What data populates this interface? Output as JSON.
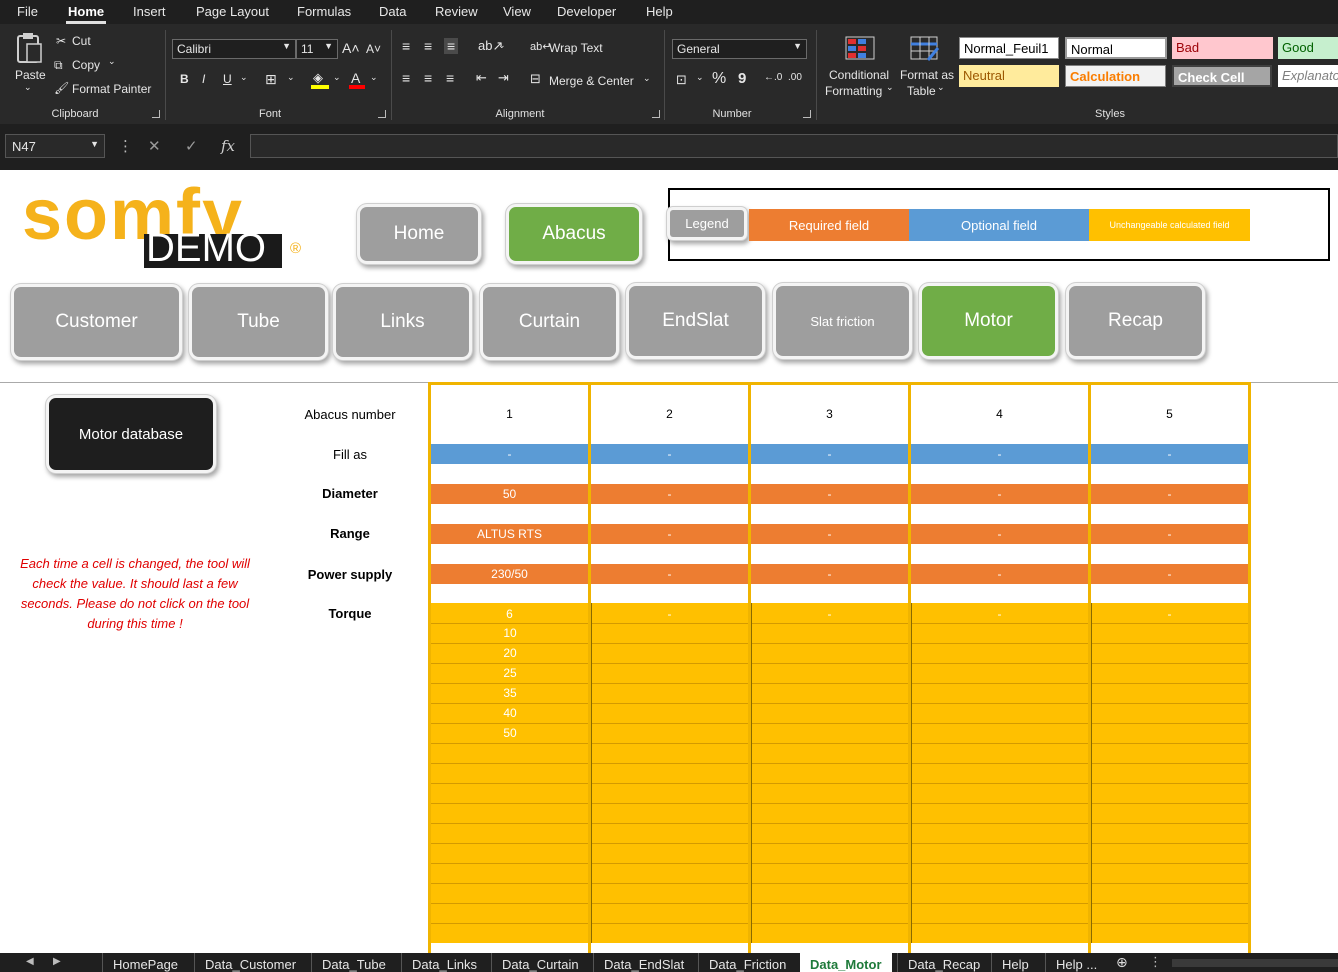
{
  "menu": {
    "items": [
      "File",
      "Home",
      "Insert",
      "Page Layout",
      "Formulas",
      "Data",
      "Review",
      "View",
      "Developer",
      "Help"
    ],
    "active": "Home"
  },
  "ribbon": {
    "clipboard": {
      "paste": "Paste",
      "cut": "Cut",
      "copy": "Copy",
      "format_painter": "Format Painter",
      "label": "Clipboard"
    },
    "font": {
      "name": "Calibri",
      "size": "11",
      "label": "Font",
      "bold": "B",
      "italic": "I",
      "underline": "U"
    },
    "alignment": {
      "wrap_text": "Wrap Text",
      "merge_center": "Merge & Center",
      "label": "Alignment"
    },
    "number": {
      "format": "General",
      "percent": "%",
      "comma": "9",
      "label": "Number"
    },
    "conditional": {
      "line1": "Conditional",
      "line2": "Formatting"
    },
    "format_table": {
      "line1": "Format as",
      "line2": "Table"
    },
    "styles": {
      "label": "Styles",
      "normal_feuil1": "Normal_Feuil1",
      "normal": "Normal",
      "bad": "Bad",
      "good": "Good",
      "neutral": "Neutral",
      "calculation": "Calculation",
      "check_cell": "Check Cell",
      "explanatory": "Explanato"
    }
  },
  "formula_bar": {
    "name_box": "N47",
    "fx": "fx",
    "value": ""
  },
  "sheet": {
    "logo_text": "somfy",
    "logo_demo": "DEMO",
    "logo_reg": "®",
    "nav_top": {
      "home": "Home",
      "abacus": "Abacus"
    },
    "legend": {
      "label": "Legend",
      "required": "Required field",
      "optional": "Optional field",
      "calculated": "Unchangeable calculated field"
    },
    "tabs_nav": [
      "Customer",
      "Tube",
      "Links",
      "Curtain",
      "EndSlat",
      "Slat friction",
      "Motor",
      "Recap"
    ],
    "motor_db_button": "Motor database",
    "note": "Each time a cell is changed, the tool will check the value. It should last a few seconds. Please do not click on the tool during this time !",
    "row_labels": {
      "abacus_number": "Abacus number",
      "fill_as": "Fill as",
      "diameter": "Diameter",
      "range": "Range",
      "power_supply": "Power supply",
      "torque": "Torque"
    },
    "columns": [
      {
        "abacus": "1",
        "fill_as": "-",
        "diameter": "50",
        "range": "ALTUS RTS",
        "power": "230/50",
        "torque_first": "6"
      },
      {
        "abacus": "2",
        "fill_as": "-",
        "diameter": "-",
        "range": "-",
        "power": "-",
        "torque_first": "-"
      },
      {
        "abacus": "3",
        "fill_as": "-",
        "diameter": "-",
        "range": "-",
        "power": "-",
        "torque_first": "-"
      },
      {
        "abacus": "4",
        "fill_as": "-",
        "diameter": "-",
        "range": "-",
        "power": "-",
        "torque_first": "-"
      },
      {
        "abacus": "5",
        "fill_as": "-",
        "diameter": "-",
        "range": "-",
        "power": "-",
        "torque_first": "-"
      }
    ],
    "torque_values_col1": [
      "6",
      "10",
      "20",
      "25",
      "35",
      "40",
      "50"
    ],
    "colors": {
      "required": "#ed7d31",
      "optional": "#5b9bd5",
      "calculated": "#ffc000",
      "active_button": "#70ad47",
      "button": "#9e9e9e"
    }
  },
  "sheet_tabs": [
    "HomePage",
    "Data_Customer",
    "Data_Tube",
    "Data_Links",
    "Data_Curtain",
    "Data_EndSlat",
    "Data_Friction",
    "Data_Motor",
    "Data_Recap",
    "Help",
    "Help ..."
  ],
  "active_sheet_tab": "Data_Motor"
}
